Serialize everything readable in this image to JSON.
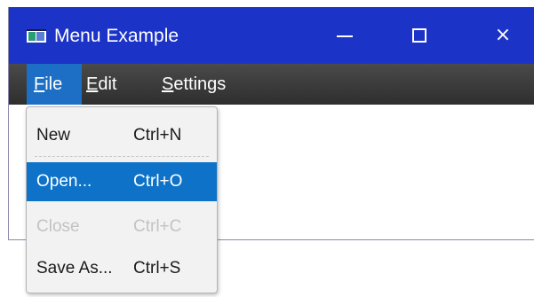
{
  "window": {
    "title": "Menu Example",
    "controls": {
      "minimize": "minimize-icon",
      "maximize": "maximize-icon",
      "close": "×"
    }
  },
  "menubar": {
    "file": {
      "mnemonic": "F",
      "rest": "ile"
    },
    "edit": {
      "mnemonic": "E",
      "rest": "dit"
    },
    "settings": {
      "mnemonic": "S",
      "rest": "ettings"
    }
  },
  "file_menu": {
    "items": [
      {
        "label": "New",
        "accelerator": "Ctrl+N",
        "enabled": true,
        "highlighted": false
      },
      {
        "label": "Open...",
        "accelerator": "Ctrl+O",
        "enabled": true,
        "highlighted": true
      },
      {
        "label": "Close",
        "accelerator": "Ctrl+C",
        "enabled": false,
        "highlighted": false
      },
      {
        "label": "Save As...",
        "accelerator": "Ctrl+S",
        "enabled": true,
        "highlighted": false
      }
    ]
  },
  "colors": {
    "titlebar": "#1c33c8",
    "menubar": "#3a3a3a",
    "selection": "#0e73c8",
    "disabled_text": "#c3c3c3"
  }
}
